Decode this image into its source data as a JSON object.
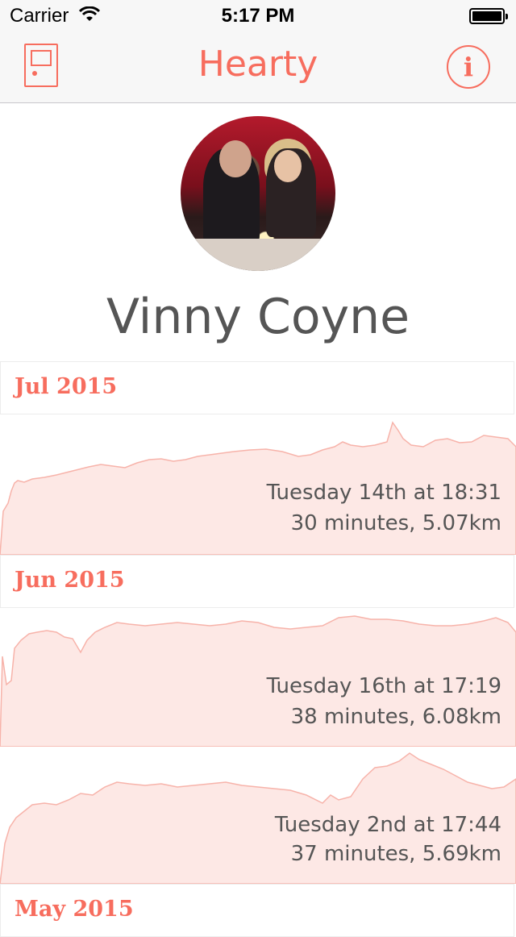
{
  "status_bar": {
    "carrier": "Carrier",
    "time": "5:17 PM"
  },
  "nav": {
    "title": "Hearty",
    "left_icon": "door-icon",
    "right_icon": "info-icon",
    "info_glyph": "i"
  },
  "profile": {
    "name": "Vinny Coyne"
  },
  "colors": {
    "accent": "#f76d5e",
    "chart_fill": "#fde8e5",
    "text": "#555555"
  },
  "sections": [
    {
      "title": "Jul 2015"
    },
    {
      "title": "Jun 2015"
    },
    {
      "title": "May 2015"
    }
  ],
  "runs": [
    {
      "date": "Tuesday 14th at 18:31",
      "stats": "30 minutes, 5.07km"
    },
    {
      "date": "Tuesday 16th at 17:19",
      "stats": "38 minutes, 6.08km"
    },
    {
      "date": "Tuesday 2nd at 17:44",
      "stats": "37 minutes, 5.69km"
    }
  ]
}
